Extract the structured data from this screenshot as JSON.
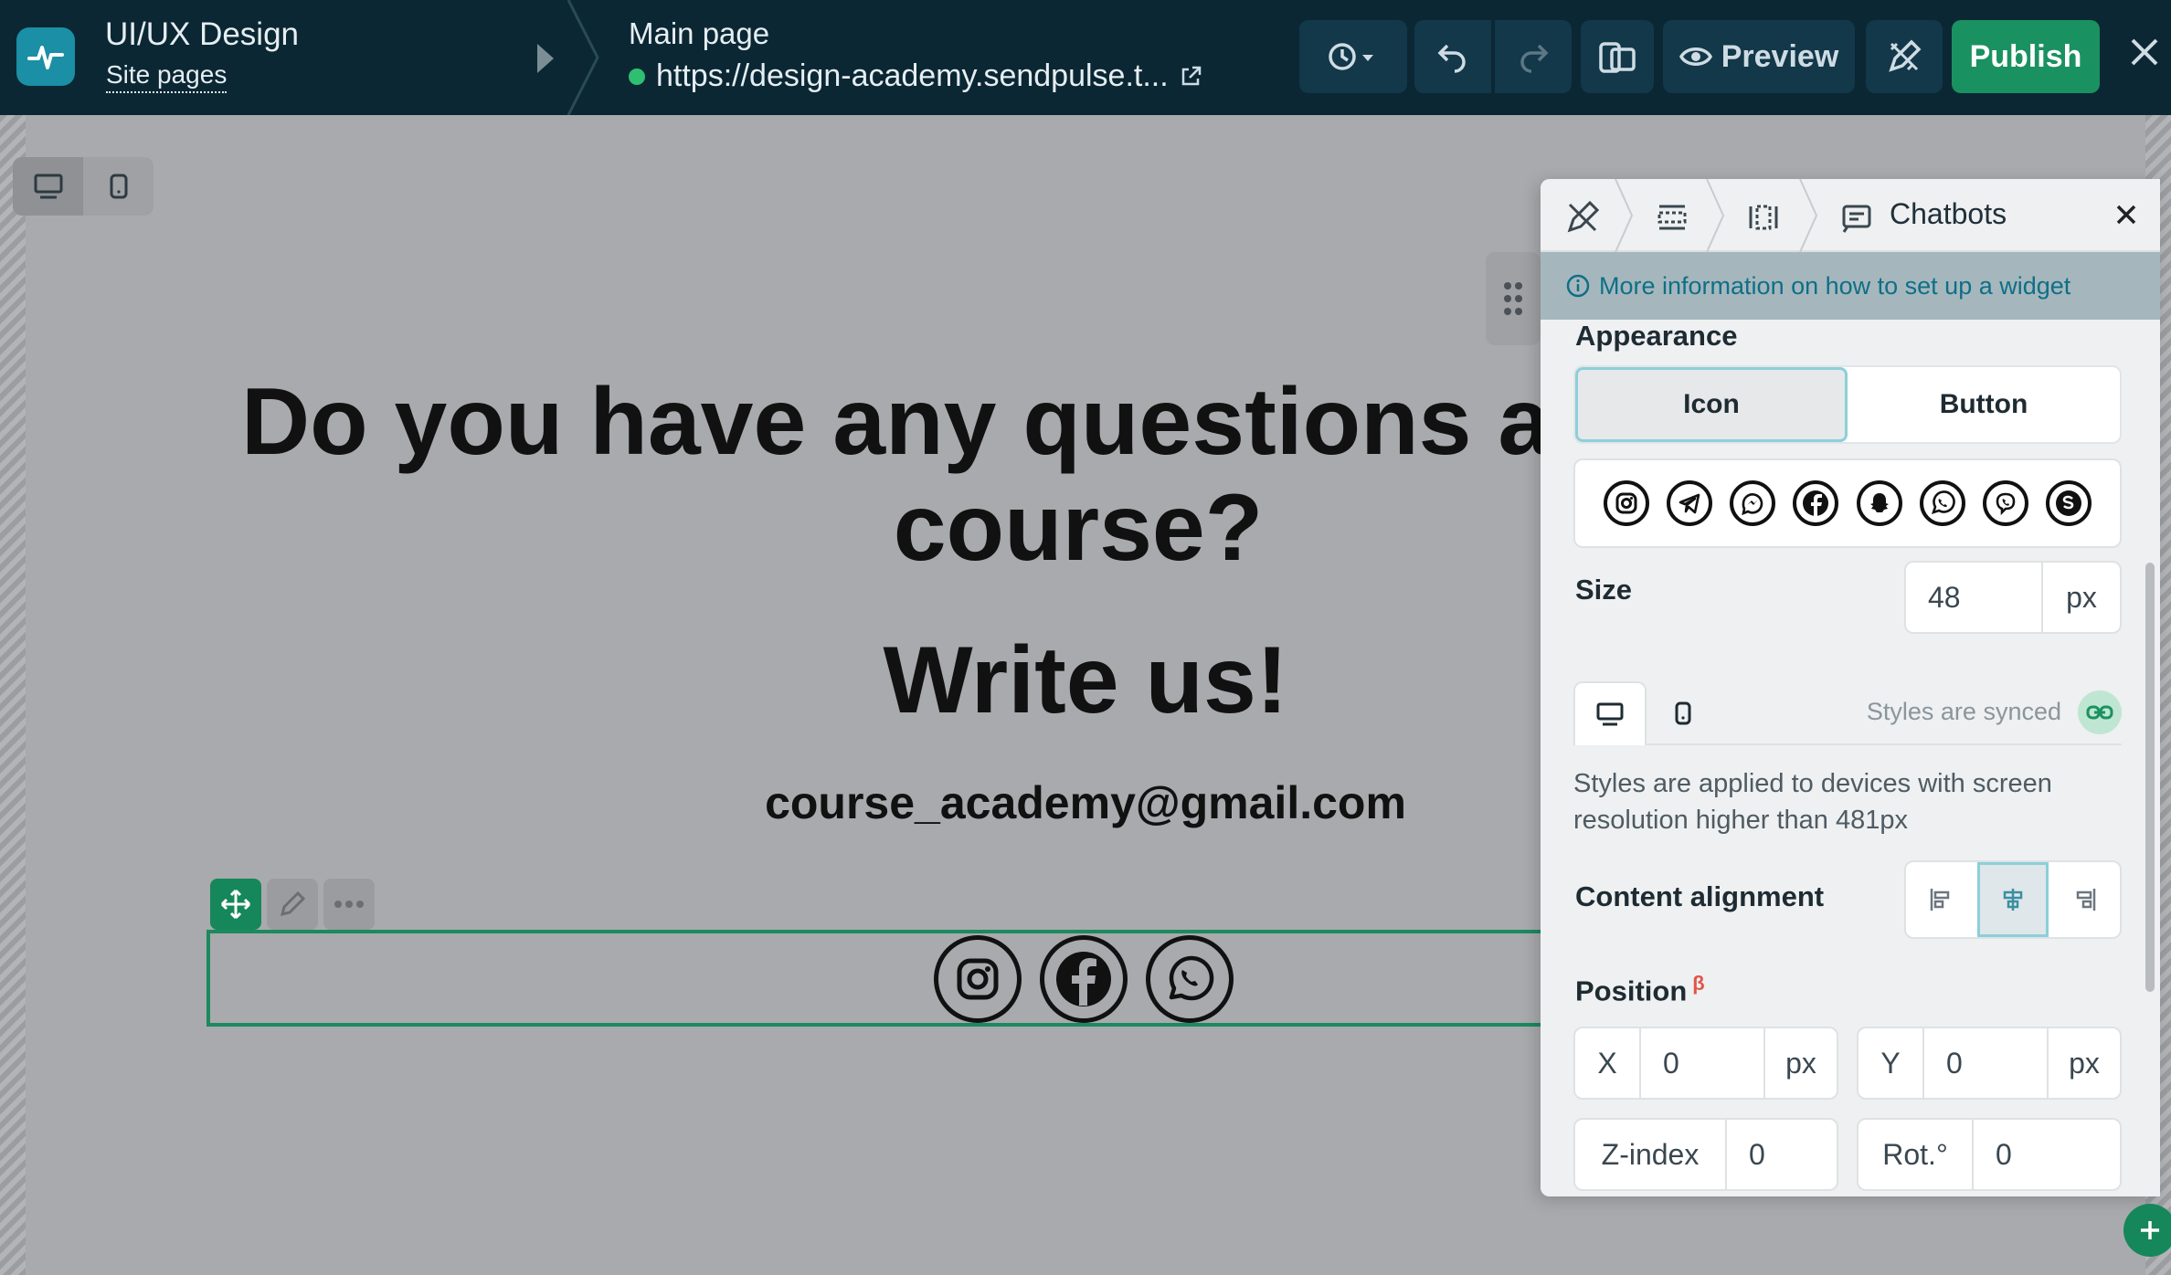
{
  "topbar": {
    "project_title": "UI/UX Design",
    "project_sub": "Site pages",
    "page_title": "Main page",
    "page_url": "https://design-academy.sendpulse.t...",
    "preview_label": "Preview",
    "publish_label": "Publish"
  },
  "canvas": {
    "headline_line1": "Do you have any questions a",
    "headline_line2": "course?",
    "headline2": "Write us!",
    "email": "course_academy@gmail.com",
    "social_icons": [
      "instagram-icon",
      "facebook-icon",
      "whatsapp-icon"
    ]
  },
  "panel": {
    "title": "Chatbots",
    "info": "More information on how to set up a widget",
    "appearance_label": "Appearance",
    "appearance_options": [
      "Icon",
      "Button"
    ],
    "appearance_selected": "Icon",
    "messenger_icons": [
      "instagram-icon",
      "telegram-icon",
      "messenger-icon",
      "facebook-icon",
      "snapchat-icon",
      "whatsapp-icon",
      "viber-icon",
      "skype-icon"
    ],
    "size_label": "Size",
    "size_value": "48",
    "size_unit": "px",
    "synced_label": "Styles are synced",
    "help_text": "Styles are applied to devices with screen resolution higher than 481px",
    "alignment_label": "Content alignment",
    "alignment_selected": "center",
    "position_label": "Position",
    "position_beta": "β",
    "x_label": "X",
    "x_value": "0",
    "y_label": "Y",
    "y_value": "0",
    "unit_px": "px",
    "zindex_label": "Z-index",
    "zindex_value": "0",
    "rot_label": "Rot.°",
    "rot_value": "0"
  },
  "colors": {
    "topbar_bg": "#0b2734",
    "publish_bg": "#1a9161",
    "accent_green": "#16875a",
    "info_text": "#0f6f86"
  }
}
